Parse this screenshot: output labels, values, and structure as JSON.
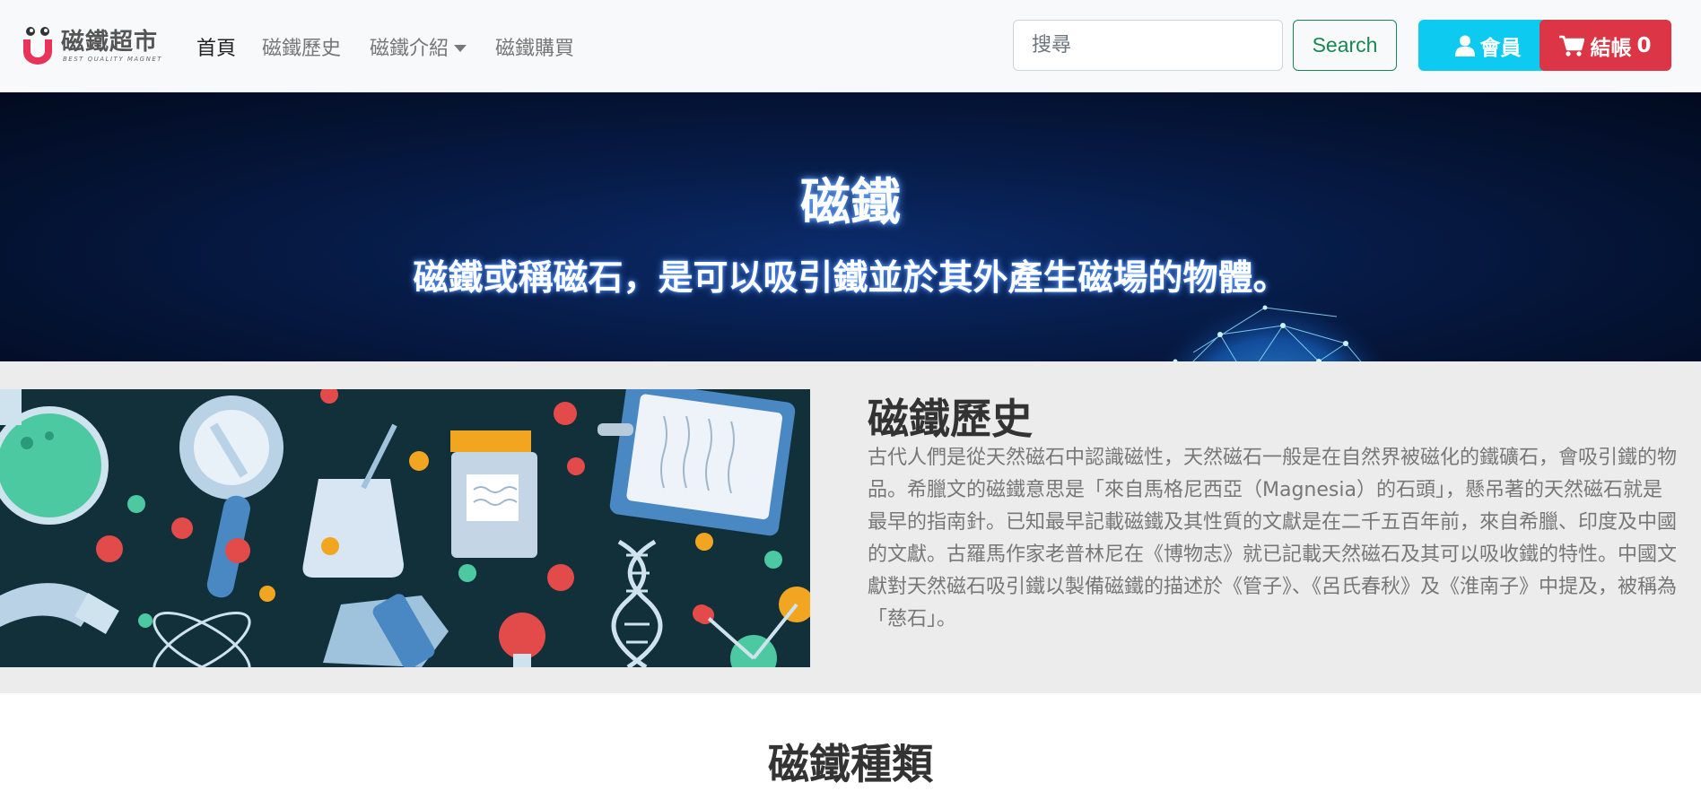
{
  "brand": {
    "name": "磁鐵超市",
    "tagline": "BEST QUALITY MAGNET"
  },
  "nav": {
    "items": [
      {
        "label": "首頁",
        "active": true
      },
      {
        "label": "磁鐵歷史",
        "active": false
      },
      {
        "label": "磁鐵介紹",
        "active": false,
        "dropdown": true
      },
      {
        "label": "磁鐵購買",
        "active": false
      }
    ]
  },
  "search": {
    "placeholder": "搜尋",
    "value": "",
    "button_label": "Search"
  },
  "member": {
    "label": "會員",
    "icon": "user-icon"
  },
  "cart": {
    "label": "結帳",
    "count": "0",
    "icon": "cart-icon"
  },
  "hero": {
    "title": "磁鐵",
    "subtitle": "磁鐵或稱磁石，是可以吸引鐵並於其外產生磁場的物體。"
  },
  "history": {
    "title": "磁鐵歷史",
    "body": "古代人們是從天然磁石中認識磁性，天然磁石一般是在自然界被磁化的鐵礦石，會吸引鐵的物品。希臘文的磁鐵意思是「來自馬格尼西亞（Magnesia）的石頭」，懸吊著的天然磁石就是最早的指南針。已知最早記載磁鐵及其性質的文獻是在二千五百年前，來自希臘、印度及中國的文獻。古羅馬作家老普林尼在《博物志》就已記載天然磁石及其可以吸收鐵的特性。中國文獻對天然磁石吸引鐵以製備磁鐵的描述於《管子》、《呂氏春秋》及《淮南子》中提及，被稱為「慈石」。"
  },
  "types": {
    "title": "磁鐵種類"
  },
  "colors": {
    "navbar_bg": "#f8f9fa",
    "member_btn": "#0dcaf0",
    "cart_btn": "#dc3545",
    "search_btn": "#198754",
    "hero_bg": "#061a44"
  }
}
